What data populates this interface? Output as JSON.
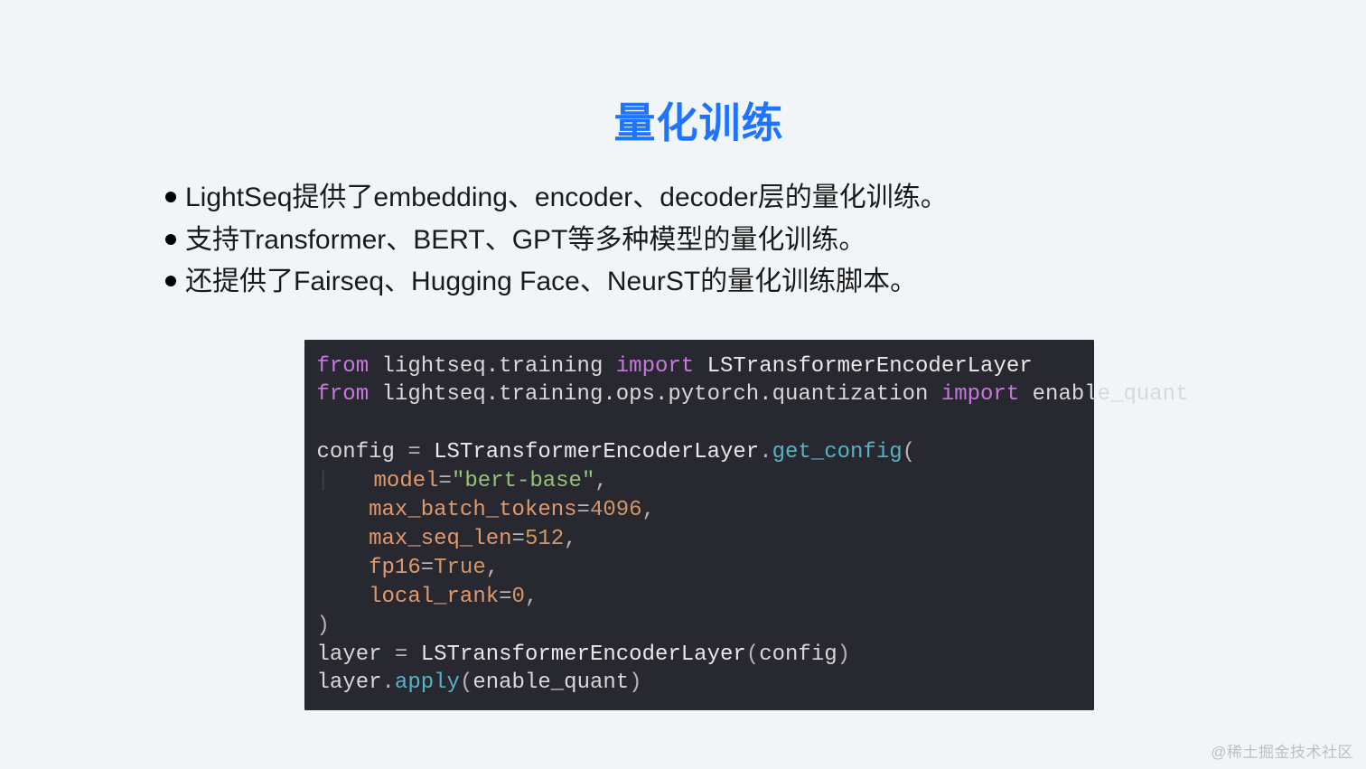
{
  "title": "量化训练",
  "bullets": [
    "LightSeq提供了embedding、encoder、decoder层的量化训练。",
    "支持Transformer、BERT、GPT等多种模型的量化训练。",
    "还提供了Fairseq、Hugging Face、NeurST的量化训练脚本。"
  ],
  "code": {
    "l1": {
      "kw_from": "from",
      "mod1": " lightseq.training ",
      "kw_import": "import",
      "cls": " LSTransformerEncoderLayer"
    },
    "l2": {
      "kw_from": "from",
      "mod2": " lightseq.training.ops.pytorch.quantization ",
      "kw_import": "import",
      "fn": " enable_quant"
    },
    "l3": "",
    "l4": {
      "a": "config ",
      "eq": "=",
      "b": " LSTransformerEncoderLayer",
      "dot": ".",
      "fn": "get_config",
      "open": "("
    },
    "l5": {
      "ind": "    ",
      "arg": "model",
      "eq": "=",
      "str": "\"bert-base\"",
      "comma": ","
    },
    "l6": {
      "ind": "    ",
      "arg": "max_batch_tokens",
      "eq": "=",
      "num": "4096",
      "comma": ","
    },
    "l7": {
      "ind": "    ",
      "arg": "max_seq_len",
      "eq": "=",
      "num": "512",
      "comma": ","
    },
    "l8": {
      "ind": "    ",
      "arg": "fp16",
      "eq": "=",
      "bool": "True",
      "comma": ","
    },
    "l9": {
      "ind": "    ",
      "arg": "local_rank",
      "eq": "=",
      "num": "0",
      "comma": ","
    },
    "l10": {
      "close": ")"
    },
    "l11": {
      "a": "layer ",
      "eq": "=",
      "b": " LSTransformerEncoderLayer",
      "open": "(",
      "c": "config",
      "close": ")"
    },
    "l12": {
      "a": "layer",
      "dot": ".",
      "fn": "apply",
      "open": "(",
      "c": "enable_quant",
      "close": ")"
    }
  },
  "watermark": "@稀土掘金技术社区"
}
